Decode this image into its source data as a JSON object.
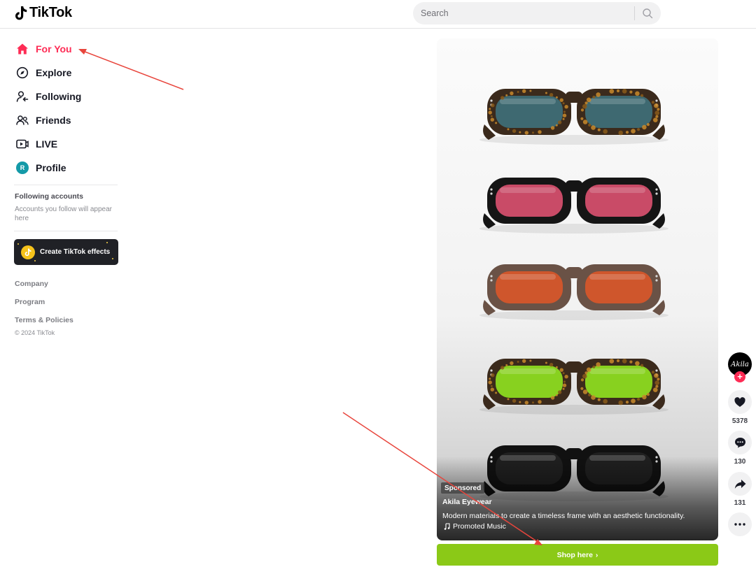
{
  "header": {
    "logo_text": "TikTok",
    "search_placeholder": "Search"
  },
  "sidebar": {
    "nav": [
      {
        "label": "For You",
        "icon": "home-icon",
        "active": true
      },
      {
        "label": "Explore",
        "icon": "compass-icon"
      },
      {
        "label": "Following",
        "icon": "user-follow-icon"
      },
      {
        "label": "Friends",
        "icon": "friends-icon"
      },
      {
        "label": "LIVE",
        "icon": "live-icon"
      },
      {
        "label": "Profile",
        "icon": "profile-avatar",
        "avatar_letter": "R"
      }
    ],
    "following_title": "Following accounts",
    "following_empty": "Accounts you follow will appear here",
    "effects_label": "Create TikTok effects",
    "footer_links": [
      "Company",
      "Program",
      "Terms & Policies"
    ],
    "copyright": "© 2024 TikTok"
  },
  "video": {
    "sponsored_label": "Sponsored",
    "author": "Akila Eyewear",
    "description": "Modern materials to create a timeless frame with an aesthetic functionality.",
    "music": "Promoted Music",
    "shop_label": "Shop here",
    "glasses_lens_colors": [
      "#3f6f78",
      "#d9506f",
      "#d8572a",
      "#8fe01f",
      "#222222"
    ],
    "glasses_frame_colors": [
      "#3b2a1c",
      "#151515",
      "#6a5246",
      "#3b2a1c",
      "#111111"
    ]
  },
  "actions": {
    "avatar_text": "Akila",
    "likes": "5378",
    "comments": "130",
    "shares": "131"
  },
  "colors": {
    "brand": "#fe2c55",
    "shop": "#8bc917",
    "annotation_arrow": "#e8453c"
  }
}
